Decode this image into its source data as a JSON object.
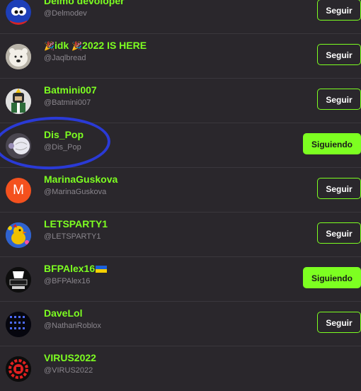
{
  "users": [
    {
      "name": "Delmo devoloper",
      "handle": "@Delmodev",
      "button": "Seguir",
      "following": false,
      "avatar": "sonic-avatar"
    },
    {
      "name_parts": [
        "🎉",
        "idk ",
        "🎉",
        "2022 IS HERE"
      ],
      "handle": "@Jaqlbread",
      "button": "Seguir",
      "following": false,
      "avatar": "polar-bear-avatar"
    },
    {
      "name": "Batmini007",
      "handle": "@Batmini007",
      "button": "Seguir",
      "following": false,
      "avatar": "roblox-character-avatar"
    },
    {
      "name": "Dis_Pop",
      "handle": "@Dis_Pop",
      "button": "Siguiendo",
      "following": true,
      "avatar": "white-ball-avatar"
    },
    {
      "name": "MarinaGuskova",
      "handle": "@MarinaGuskova",
      "button": "Seguir",
      "following": false,
      "avatar_letter": "M",
      "avatar_color": "#f4511e"
    },
    {
      "name": "LETSPARTY1",
      "handle": "@LETSPARTY1",
      "button": "Seguir",
      "following": false,
      "avatar": "party-duck-avatar"
    },
    {
      "name": "BFPAlex16",
      "handle": "@BFPAlex16",
      "button": "Siguiendo",
      "following": true,
      "avatar": "art-studio-avatar",
      "flag": "ukraine-flag-icon"
    },
    {
      "name": "DaveLol",
      "handle": "@NathanRoblox",
      "button": "Seguir",
      "following": false,
      "avatar": "blue-dots-avatar"
    },
    {
      "name": "VIRUS2022",
      "handle": "@VIRUS2022",
      "button": "",
      "following": false,
      "avatar": "red-gear-avatar"
    }
  ],
  "colors": {
    "accent": "#7dff21",
    "background": "#2a272c",
    "annotation": "#2a3ad6"
  }
}
